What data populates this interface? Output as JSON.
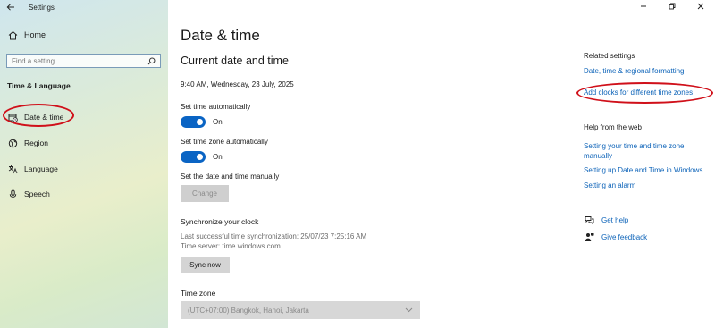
{
  "app": {
    "title": "Settings"
  },
  "sidebar": {
    "home_label": "Home",
    "search_placeholder": "Find a setting",
    "section_title": "Time & Language",
    "items": [
      {
        "label": "Date & time",
        "icon": "calendar-clock-icon"
      },
      {
        "label": "Region",
        "icon": "globe-icon"
      },
      {
        "label": "Language",
        "icon": "language-icon"
      },
      {
        "label": "Speech",
        "icon": "microphone-icon"
      }
    ]
  },
  "main": {
    "page_title": "Date & time",
    "section_title": "Current date and time",
    "current_datetime": "9:40 AM, Wednesday, 23 July, 2025",
    "set_time_auto_label": "Set time automatically",
    "set_time_auto_state": "On",
    "set_tz_auto_label": "Set time zone automatically",
    "set_tz_auto_state": "On",
    "set_manual_label": "Set the date and time manually",
    "change_button": "Change",
    "sync_title": "Synchronize your clock",
    "last_sync": "Last successful time synchronization: 25/07/23 7:25:16 AM",
    "time_server": "Time server: time.windows.com",
    "sync_button": "Sync now",
    "timezone_label": "Time zone",
    "timezone_value": "(UTC+07:00) Bangkok, Hanoi, Jakarta"
  },
  "related": {
    "title": "Related settings",
    "links": [
      "Date, time & regional formatting",
      "Add clocks for different time zones"
    ]
  },
  "help": {
    "title": "Help from the web",
    "links": [
      "Setting your time and time zone manually",
      "Setting up Date and Time in Windows",
      "Setting an alarm"
    ],
    "get_help": "Get help",
    "give_feedback": "Give feedback"
  },
  "colors": {
    "accent": "#0a64c4",
    "link": "#0b62b8",
    "highlight_oval": "#d0101a"
  }
}
